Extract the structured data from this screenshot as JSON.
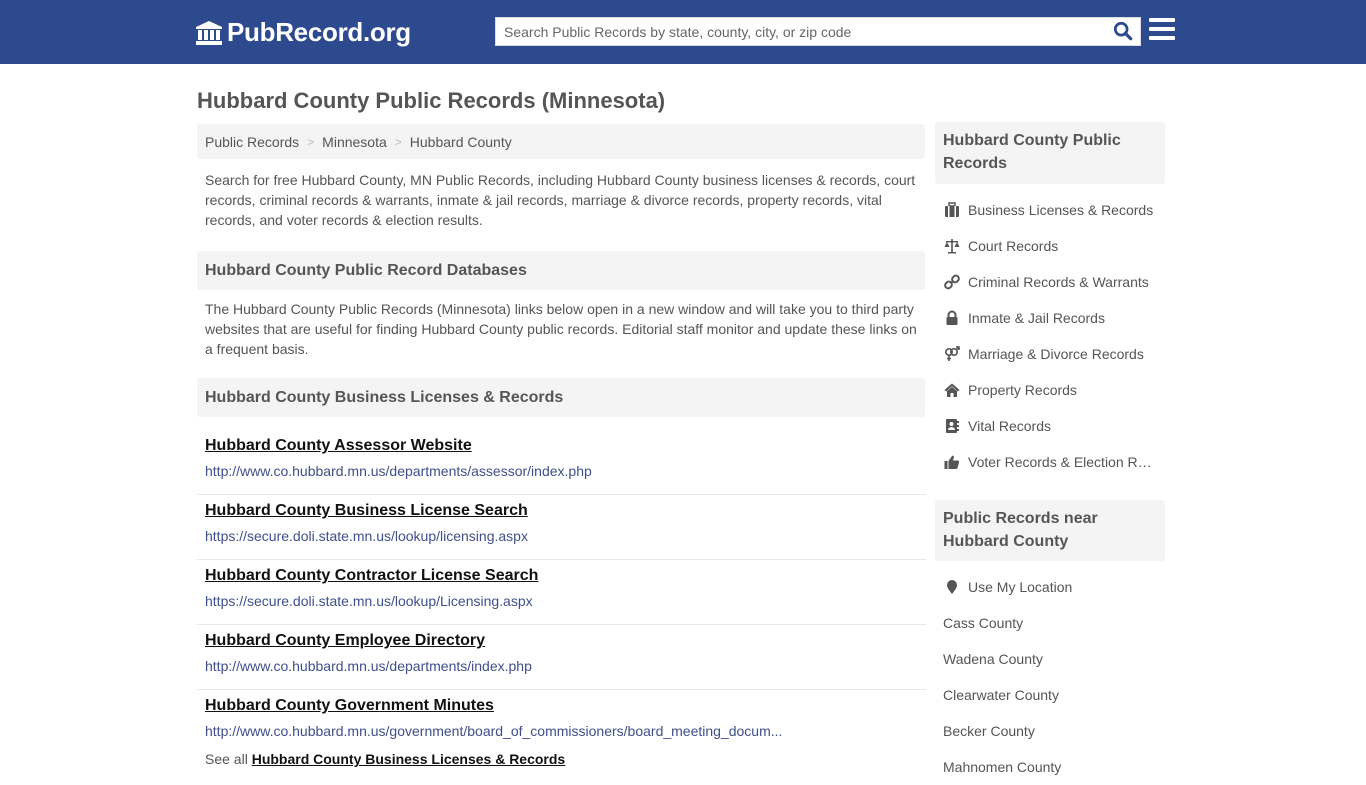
{
  "header": {
    "logo_text": "PubRecord.org",
    "search_placeholder": "Search Public Records by state, county, city, or zip code",
    "brand_color": "#2e4a8f"
  },
  "page": {
    "title": "Hubbard County Public Records (Minnesota)",
    "breadcrumb": [
      "Public Records",
      "Minnesota",
      "Hubbard County"
    ],
    "intro": "Search for free Hubbard County, MN Public Records, including Hubbard County business licenses & records, court records, criminal records & warrants, inmate & jail records, marriage & divorce records, property records, vital records, and voter records & election results."
  },
  "databases": {
    "heading": "Hubbard County Public Record Databases",
    "description": "The Hubbard County Public Records (Minnesota) links below open in a new window and will take you to third party websites that are useful for finding Hubbard County public records. Editorial staff monitor and update these links on a frequent basis."
  },
  "business": {
    "heading": "Hubbard County Business Licenses & Records",
    "links": [
      {
        "title": "Hubbard County Assessor Website",
        "url": "http://www.co.hubbard.mn.us/departments/assessor/index.php"
      },
      {
        "title": "Hubbard County Business License Search",
        "url": "https://secure.doli.state.mn.us/lookup/licensing.aspx"
      },
      {
        "title": "Hubbard County Contractor License Search",
        "url": "https://secure.doli.state.mn.us/lookup/Licensing.aspx"
      },
      {
        "title": "Hubbard County Employee Directory",
        "url": "http://www.co.hubbard.mn.us/departments/index.php"
      },
      {
        "title": "Hubbard County Government Minutes",
        "url": "http://www.co.hubbard.mn.us/government/board_of_commissioners/board_meeting_docum..."
      }
    ],
    "see_all_prefix": "See all",
    "see_all_link": "Hubbard County Business Licenses & Records"
  },
  "sidebar": {
    "records_heading": "Hubbard County Public Records",
    "records": [
      {
        "label": "Business Licenses & Records",
        "icon": "briefcase-icon"
      },
      {
        "label": "Court Records",
        "icon": "balance-scale-icon"
      },
      {
        "label": "Criminal Records & Warrants",
        "icon": "link-icon"
      },
      {
        "label": "Inmate & Jail Records",
        "icon": "lock-icon"
      },
      {
        "label": "Marriage & Divorce Records",
        "icon": "venus-mars-icon"
      },
      {
        "label": "Property Records",
        "icon": "home-icon"
      },
      {
        "label": "Vital Records",
        "icon": "address-book-icon"
      },
      {
        "label": "Voter Records & Election Results",
        "icon": "thumbs-up-icon"
      }
    ],
    "nearby_heading": "Public Records near Hubbard County",
    "use_location": "Use My Location",
    "nearby": [
      "Cass County",
      "Wadena County",
      "Clearwater County",
      "Becker County",
      "Mahnomen County"
    ]
  }
}
